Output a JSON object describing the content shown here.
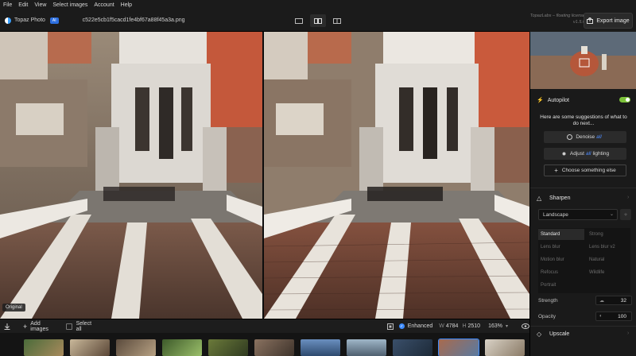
{
  "menu": [
    "File",
    "Edit",
    "View",
    "Select images",
    "Account",
    "Help"
  ],
  "app": {
    "name": "Topaz Photo",
    "badge": "AI"
  },
  "file": {
    "name": "c522e5cb1f5cacd1fe4bf67a88f45a3a.png"
  },
  "view_modes": [
    {
      "name": "single-view",
      "active": false
    },
    {
      "name": "side-by-side-view",
      "active": true
    },
    {
      "name": "split-view",
      "active": false
    }
  ],
  "license": {
    "line1": "TopazLabs – floating license",
    "line2": "v1.5.0"
  },
  "export": {
    "label": "Export image"
  },
  "original_label": "Original",
  "bottom_bar": {
    "add_images": "Add images",
    "select_all": "Select all",
    "enhanced": "Enhanced",
    "width_label": "W",
    "width": "4784",
    "height_label": "H",
    "height": "2510",
    "zoom": "163%"
  },
  "panel": {
    "autopilot": {
      "label": "Autopilot",
      "enabled": true
    },
    "suggestions_text": "Here are some suggestions of what to do next...",
    "denoise": {
      "prefix": "Denoise",
      "emph": "all"
    },
    "adjust": {
      "prefix": "Adjust",
      "emph": "all",
      "suffix": "lighting"
    },
    "choose": "Choose something else",
    "sharpen": {
      "title": "Sharpen",
      "preset": "Landscape",
      "models": [
        "Standard",
        "Strong",
        "Lens blur",
        "Lens blur v2",
        "Motion blur",
        "Natural",
        "Refocus",
        "Wildlife",
        "Portrait"
      ],
      "active_model": "Standard",
      "strength_label": "Strength",
      "strength": "32",
      "opacity_label": "Opacity",
      "opacity": "100"
    },
    "upscale": {
      "title": "Upscale"
    }
  },
  "colors": {
    "accent": "#3d8bff",
    "toggle_on": "#7cc23a"
  }
}
